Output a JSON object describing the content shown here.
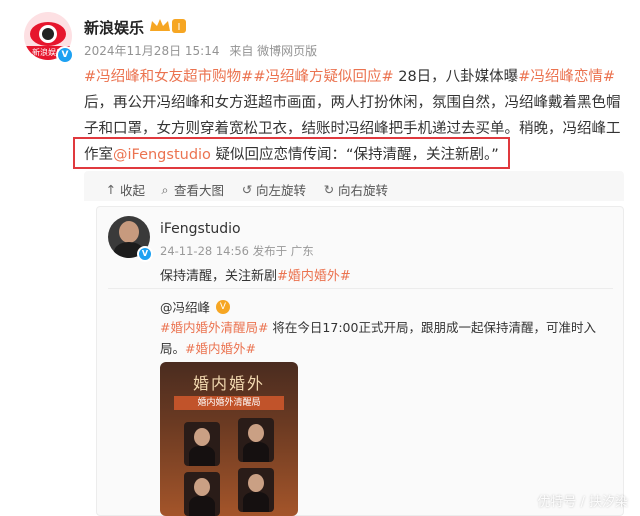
{
  "post": {
    "username": "新浪娱乐",
    "level_badge": "I",
    "avatar_label": "新浪娱乐",
    "timestamp": "2024年11月28日 15:14",
    "source": "来自 微博网页版",
    "body": {
      "tag1": "#冯绍峰和女友超市购物#",
      "tag2": "#冯绍峰方疑似回应#",
      "text1": " 28日，八卦媒体曝",
      "tag3": "#冯绍峰恋情#",
      "text2": "后，再公开冯绍峰和女方逛超市画面，两人打扮休闲，氛围自然，冯绍峰戴着黑色帽子和口罩，女方则穿着宽松卫衣，结账时冯绍峰把手机递过去买单。稍晚，冯绍峰工作室",
      "mention": "@iFengstudio",
      "text3": " 疑似回应恋情传闻：“保持清醒，关注新剧。”"
    }
  },
  "toolbar": {
    "collapse": "收起",
    "view_large": "查看大图",
    "rotate_left": "向左旋转",
    "rotate_right": "向右旋转"
  },
  "shared": {
    "username": "iFengstudio",
    "meta": "24-11-28 14:56  发布于 广东",
    "text": "保持清醒，关注新剧",
    "tag": "#婚内婚外#"
  },
  "quoted": {
    "author": "@冯绍峰",
    "tag1": "#婚内婚外清醒局#",
    "text": " 将在今日17:00正式开局，跟朋成一起保持清醒，可准时入局。",
    "tag2": "#婚内婚外#"
  },
  "poster": {
    "title": "婚内婚外",
    "subtitle": "婚内婚外清醒局"
  },
  "watermark": "优特号 / 扶汐染",
  "colors": {
    "tag": "#eb7350",
    "highlight": "#e0393e",
    "verified": "#1da1f2"
  }
}
